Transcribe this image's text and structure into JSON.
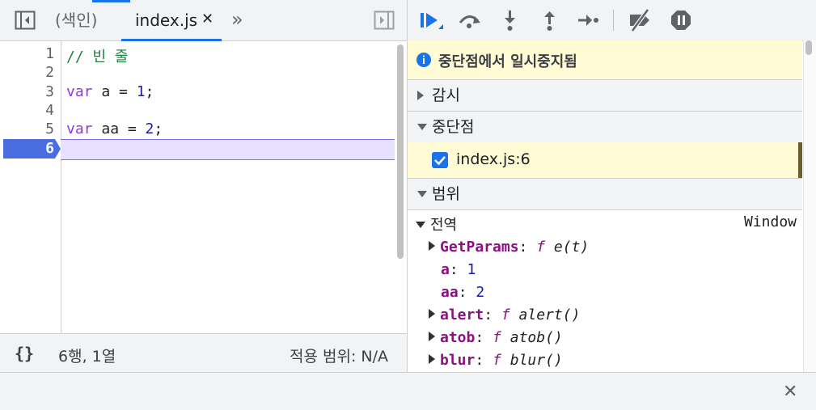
{
  "editor": {
    "tabs": [
      {
        "label": "(색인)"
      },
      {
        "label": "index.js",
        "close": "✕"
      }
    ],
    "more_tabs": "»",
    "lines": [
      {
        "num": "1",
        "tokens": [
          {
            "t": "// 빈 줄",
            "c": "comment"
          }
        ]
      },
      {
        "num": "2",
        "tokens": []
      },
      {
        "num": "3",
        "tokens": [
          {
            "t": "var",
            "c": "kw"
          },
          {
            "t": " a = ",
            "c": "plain"
          },
          {
            "t": "1",
            "c": "num"
          },
          {
            "t": ";",
            "c": "plain"
          }
        ]
      },
      {
        "num": "4",
        "tokens": []
      },
      {
        "num": "5",
        "tokens": [
          {
            "t": "var",
            "c": "kw"
          },
          {
            "t": " aa = ",
            "c": "plain"
          },
          {
            "t": "2",
            "c": "num"
          },
          {
            "t": ";",
            "c": "plain"
          }
        ]
      },
      {
        "num": "6",
        "tokens": []
      }
    ],
    "active_line": "6",
    "status": {
      "braces": "{}",
      "position": "6행, 1열",
      "coverage": "적용 범위: N/A"
    }
  },
  "debugger": {
    "paused_text": "중단점에서 일시중지됨",
    "sections": {
      "watch": "감시",
      "breakpoints": "중단점",
      "scope": "범위"
    },
    "breakpoint_item": "index.js:6",
    "scope": {
      "global_label": "전역",
      "global_value": "Window",
      "entries": [
        {
          "key": "GetParams",
          "sep": ": ",
          "f": "f",
          "val": " e(t)",
          "expandable": true
        },
        {
          "key": "a",
          "sep": ": ",
          "f": "",
          "val": "1",
          "expandable": false
        },
        {
          "key": "aa",
          "sep": ": ",
          "f": "",
          "val": "2",
          "expandable": false
        },
        {
          "key": "alert",
          "sep": ": ",
          "f": "f",
          "val": " alert()",
          "expandable": true
        },
        {
          "key": "atob",
          "sep": ": ",
          "f": "f",
          "val": " atob()",
          "expandable": true
        },
        {
          "key": "blur",
          "sep": ": ",
          "f": "f",
          "val": " blur()",
          "expandable": true
        }
      ]
    }
  },
  "bottom": {
    "close": "✕"
  },
  "colors": {
    "accent": "#1a73e8",
    "paused_bg": "#fefbd5",
    "exec_line": "#e8e0ff"
  }
}
